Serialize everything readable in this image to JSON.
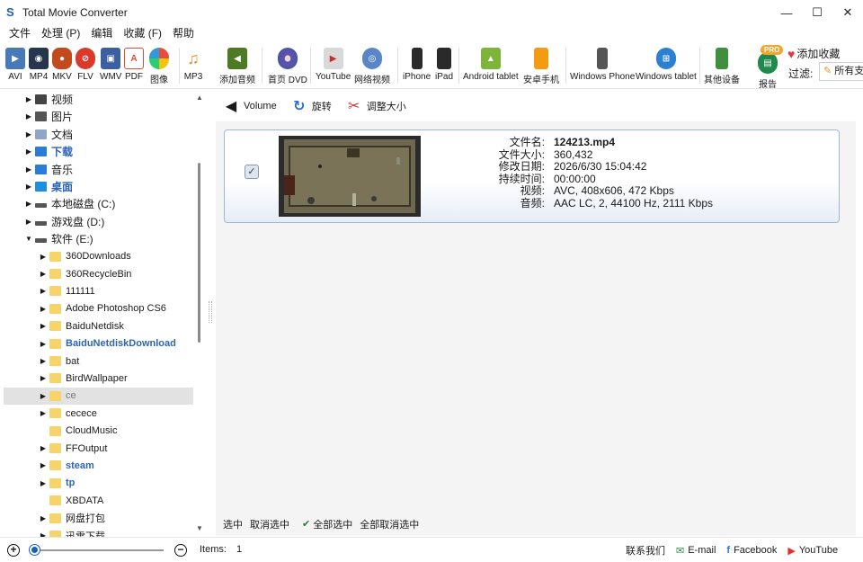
{
  "window": {
    "title": "Total Movie Converter",
    "minimize": "—",
    "maximize": "☐",
    "close": "✕"
  },
  "menu": [
    "文件",
    "处理 (P)",
    "编辑",
    "收藏 (F)",
    "帮助"
  ],
  "toolbar": {
    "items": [
      {
        "label": "AVI",
        "icon": "avi-icon"
      },
      {
        "label": "MP4",
        "icon": "mp4-icon"
      },
      {
        "label": "MKV",
        "icon": "mkv-icon"
      },
      {
        "label": "FLV",
        "icon": "flv-icon"
      },
      {
        "label": "WMV",
        "icon": "wmv-icon"
      },
      {
        "label": "PDF",
        "icon": "pdf-icon"
      },
      {
        "label": "图像",
        "icon": "image-icon"
      },
      {
        "label": "MP3",
        "icon": "mp3-icon"
      },
      {
        "label": "添加音频",
        "icon": "add-audio-icon"
      },
      {
        "label": "首页 DVD",
        "icon": "dvd-icon"
      },
      {
        "label": "YouTube",
        "icon": "youtube-icon"
      },
      {
        "label": "网络视频",
        "icon": "web-video-icon"
      },
      {
        "label": "iPhone",
        "icon": "iphone-icon"
      },
      {
        "label": "iPad",
        "icon": "ipad-icon"
      },
      {
        "label": "Android tablet",
        "icon": "android-icon"
      },
      {
        "label": "安卓手机",
        "icon": "android-phone-icon"
      },
      {
        "label": "Windows Phone",
        "icon": "windows-phone-icon"
      },
      {
        "label": "Windows tablet",
        "icon": "windows-tablet-icon"
      },
      {
        "label": "其他设备",
        "icon": "other-device-icon"
      },
      {
        "label": "报告",
        "icon": "report-icon"
      }
    ],
    "pro_badge": "PRO",
    "add_favorite": "添加收藏",
    "filter_label": "过滤:",
    "filter_value": "所有支持的文件"
  },
  "tree": [
    {
      "label": "视频",
      "level": 0,
      "icon": "video-folder-icon",
      "arrow": "▶"
    },
    {
      "label": "图片",
      "level": 0,
      "icon": "pictures-folder-icon",
      "arrow": "▶"
    },
    {
      "label": "文档",
      "level": 0,
      "icon": "documents-folder-icon",
      "arrow": "▶"
    },
    {
      "label": "下载",
      "level": 0,
      "icon": "download-folder-icon",
      "arrow": "▶",
      "bold": true
    },
    {
      "label": "音乐",
      "level": 0,
      "icon": "music-folder-icon",
      "arrow": "▶"
    },
    {
      "label": "桌面",
      "level": 0,
      "icon": "desktop-folder-icon",
      "arrow": "▶",
      "bold": true
    },
    {
      "label": "本地磁盘 (C:)",
      "level": 0,
      "icon": "drive-icon",
      "arrow": "▶"
    },
    {
      "label": "游戏盘 (D:)",
      "level": 0,
      "icon": "drive-icon",
      "arrow": "▶"
    },
    {
      "label": "软件 (E:)",
      "level": 0,
      "icon": "drive-icon",
      "arrow": "▼"
    },
    {
      "label": "360Downloads",
      "level": 1,
      "icon": "folder-icon",
      "arrow": "▶"
    },
    {
      "label": "360RecycleBin",
      "level": 1,
      "icon": "folder-icon",
      "arrow": "▶"
    },
    {
      "label": "111111",
      "level": 1,
      "icon": "folder-icon",
      "arrow": "▶"
    },
    {
      "label": "Adobe Photoshop CS6",
      "level": 1,
      "icon": "folder-icon",
      "arrow": "▶"
    },
    {
      "label": "BaiduNetdisk",
      "level": 1,
      "icon": "folder-icon",
      "arrow": "▶"
    },
    {
      "label": "BaiduNetdiskDownload",
      "level": 1,
      "icon": "folder-icon",
      "arrow": "▶",
      "bold": true
    },
    {
      "label": "bat",
      "level": 1,
      "icon": "folder-icon",
      "arrow": "▶"
    },
    {
      "label": "BirdWallpaper",
      "level": 1,
      "icon": "folder-icon",
      "arrow": "▶"
    },
    {
      "label": "ce",
      "level": 1,
      "icon": "folder-icon",
      "arrow": "▶",
      "selected": true,
      "grey": true
    },
    {
      "label": "cecece",
      "level": 1,
      "icon": "folder-icon",
      "arrow": "▶"
    },
    {
      "label": "CloudMusic",
      "level": 1,
      "icon": "folder-icon",
      "arrow": ""
    },
    {
      "label": "FFOutput",
      "level": 1,
      "icon": "folder-icon",
      "arrow": "▶"
    },
    {
      "label": "steam",
      "level": 1,
      "icon": "folder-icon",
      "arrow": "▶",
      "bold": true
    },
    {
      "label": "tp",
      "level": 1,
      "icon": "folder-icon",
      "arrow": "▶",
      "bold": true
    },
    {
      "label": "XBDATA",
      "level": 1,
      "icon": "folder-icon",
      "arrow": ""
    },
    {
      "label": "网盘打包",
      "level": 1,
      "icon": "folder-icon",
      "arrow": "▶"
    },
    {
      "label": "迅雷下载",
      "level": 1,
      "icon": "folder-icon",
      "arrow": "▶"
    }
  ],
  "actions": [
    {
      "label": "Volume",
      "icon": "volume-icon"
    },
    {
      "label": "旋转",
      "icon": "rotate-icon"
    },
    {
      "label": "调整大小",
      "icon": "resize-icon"
    }
  ],
  "file": {
    "checked": "✓",
    "fields": [
      {
        "key": "文件名:",
        "value": "124213.mp4",
        "bold": true
      },
      {
        "key": "文件大小:",
        "value": "360,432"
      },
      {
        "key": "修改日期:",
        "value": "2026/6/30 15:04:42"
      },
      {
        "key": "持续时间:",
        "value": "00:00:00"
      },
      {
        "key": "视频:",
        "value": "AVC, 408x606, 472 Kbps"
      },
      {
        "key": "音频:",
        "value": "AAC LC, 2, 44100 Hz, 2111 Kbps"
      }
    ]
  },
  "selection": {
    "select": "选中",
    "deselect": "取消选中",
    "select_all": "全部选中",
    "deselect_all": "全部取消选中"
  },
  "status": {
    "zoom_in": "+",
    "zoom_out": "−",
    "zoom_level": 0.0,
    "items_label": "Items:",
    "items_value": "1",
    "contact": "联系我们",
    "email": "E-mail",
    "facebook": "Facebook",
    "youtube": "YouTube"
  },
  "colors": {
    "accent": "#1a5fb4",
    "bold_folder": "#2c64b3",
    "card_border": "#9fb7d6",
    "selection": "#e2e2e2"
  }
}
